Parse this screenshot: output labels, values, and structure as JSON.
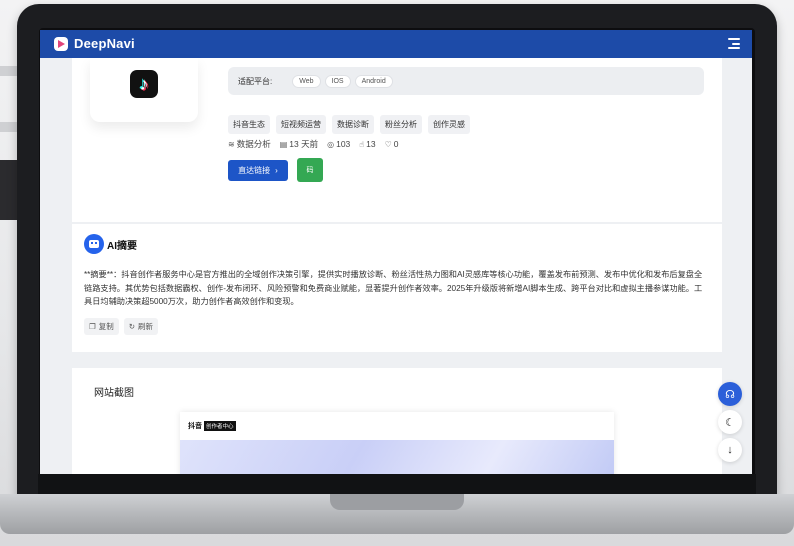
{
  "app": {
    "name": "DeepNavi"
  },
  "tool": {
    "platform_label": "适配平台:",
    "platforms": [
      "Web",
      "IOS",
      "Android"
    ],
    "tags": [
      "抖音生态",
      "短视频运营",
      "数据诊断",
      "粉丝分析",
      "创作灵感"
    ],
    "category": "数据分析",
    "updated": "13 天前",
    "views": "103",
    "clicks": "13",
    "likes": "0",
    "visit_label": "直达链接",
    "code_label": "码"
  },
  "ai_summary": {
    "title": "AI摘要",
    "text": "**摘要**：抖音创作者服务中心是官方推出的全域创作决策引擎，提供实时播放诊断、粉丝活性热力图和AI灵感库等核心功能，覆盖发布前预测、发布中优化和发布后复盘全链路支持。其优势包括数据霸权、创作-发布闭环、风险预警和免费商业赋能，显著提升创作者效率。2025年升级版将新增AI脚本生成、跨平台对比和虚拟主播参谋功能。工具日均辅助决策超5000万次，助力创作者高效创作和变现。",
    "copy_label": "复制",
    "refresh_label": "刷新"
  },
  "screenshot_section": {
    "title": "网站截图",
    "preview_brand": "抖音",
    "preview_badge": "创作者中心"
  },
  "icons": {
    "menu": "hamburger-icon",
    "moon": "moon-icon",
    "down": "arrow-down-icon",
    "help": "support-icon"
  },
  "colors": {
    "brand": "#1d4ba8",
    "primary": "#1d55c7",
    "success": "#34a853"
  }
}
